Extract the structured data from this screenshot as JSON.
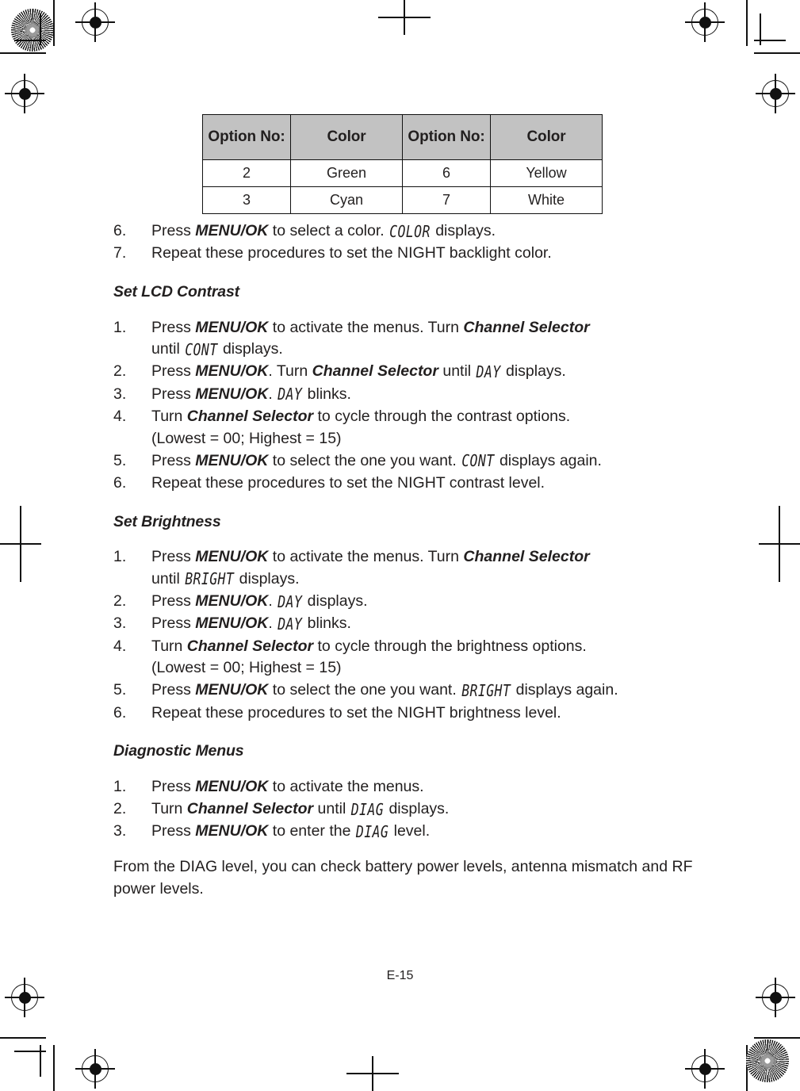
{
  "page": {
    "footer_label": "E-15"
  },
  "color_table": {
    "headers": [
      "Option No:",
      "Color",
      "Option No:",
      "Color"
    ],
    "rows": [
      [
        "2",
        "Green",
        "6",
        "Yellow"
      ],
      [
        "3",
        "Cyan",
        "7",
        "White"
      ]
    ]
  },
  "top_steps": [
    {
      "num": "6.",
      "parts": [
        {
          "t": "text",
          "v": "Press "
        },
        {
          "t": "bold",
          "v": "MENU/OK"
        },
        {
          "t": "text",
          "v": " to select a color. "
        },
        {
          "t": "lcd",
          "v": "COLOR"
        },
        {
          "t": "text",
          "v": " displays."
        }
      ]
    },
    {
      "num": "7.",
      "parts": [
        {
          "t": "text",
          "v": "Repeat these procedures to set the NIGHT backlight color."
        }
      ]
    }
  ],
  "sections": [
    {
      "heading": "Set LCD Contrast",
      "steps": [
        {
          "num": "1.",
          "parts": [
            {
              "t": "text",
              "v": "Press "
            },
            {
              "t": "bold",
              "v": "MENU/OK"
            },
            {
              "t": "text",
              "v": " to activate the menus. Turn "
            },
            {
              "t": "bold",
              "v": "Channel Selector"
            },
            {
              "t": "br"
            },
            {
              "t": "text",
              "v": "until "
            },
            {
              "t": "lcd",
              "v": "CONT"
            },
            {
              "t": "text",
              "v": " displays."
            }
          ]
        },
        {
          "num": "2.",
          "parts": [
            {
              "t": "text",
              "v": "Press "
            },
            {
              "t": "bold",
              "v": "MENU/OK"
            },
            {
              "t": "text",
              "v": ". Turn "
            },
            {
              "t": "bold",
              "v": "Channel Selector"
            },
            {
              "t": "text",
              "v": " until "
            },
            {
              "t": "lcd",
              "v": "DAY"
            },
            {
              "t": "text",
              "v": " displays."
            }
          ]
        },
        {
          "num": "3.",
          "parts": [
            {
              "t": "text",
              "v": "Press "
            },
            {
              "t": "bold",
              "v": "MENU/OK"
            },
            {
              "t": "text",
              "v": ". "
            },
            {
              "t": "lcd",
              "v": "DAY"
            },
            {
              "t": "text",
              "v": " blinks."
            }
          ]
        },
        {
          "num": "4.",
          "parts": [
            {
              "t": "text",
              "v": "Turn "
            },
            {
              "t": "bold",
              "v": "Channel Selector"
            },
            {
              "t": "text",
              "v": " to cycle through the contrast options."
            },
            {
              "t": "br"
            },
            {
              "t": "text",
              "v": "(Lowest = 00; Highest = 15)"
            }
          ]
        },
        {
          "num": "5.",
          "parts": [
            {
              "t": "text",
              "v": "Press "
            },
            {
              "t": "bold",
              "v": "MENU/OK"
            },
            {
              "t": "text",
              "v": " to select the one you want. "
            },
            {
              "t": "lcd",
              "v": "CONT"
            },
            {
              "t": "text",
              "v": " displays again."
            }
          ]
        },
        {
          "num": "6.",
          "parts": [
            {
              "t": "text",
              "v": "Repeat these procedures to set the NIGHT contrast level."
            }
          ]
        }
      ]
    },
    {
      "heading": "Set Brightness",
      "steps": [
        {
          "num": "1.",
          "parts": [
            {
              "t": "text",
              "v": "Press "
            },
            {
              "t": "bold",
              "v": "MENU/OK"
            },
            {
              "t": "text",
              "v": " to activate the menus. Turn "
            },
            {
              "t": "bold",
              "v": "Channel Selector"
            },
            {
              "t": "br"
            },
            {
              "t": "text",
              "v": "until "
            },
            {
              "t": "lcd",
              "v": "BRIGHT"
            },
            {
              "t": "text",
              "v": " displays."
            }
          ]
        },
        {
          "num": "2.",
          "parts": [
            {
              "t": "text",
              "v": "Press "
            },
            {
              "t": "bold",
              "v": "MENU/OK"
            },
            {
              "t": "text",
              "v": ". "
            },
            {
              "t": "lcd",
              "v": "DAY"
            },
            {
              "t": "text",
              "v": " displays."
            }
          ]
        },
        {
          "num": "3.",
          "parts": [
            {
              "t": "text",
              "v": "Press "
            },
            {
              "t": "bold",
              "v": "MENU/OK"
            },
            {
              "t": "text",
              "v": ". "
            },
            {
              "t": "lcd",
              "v": "DAY"
            },
            {
              "t": "text",
              "v": " blinks."
            }
          ]
        },
        {
          "num": "4.",
          "parts": [
            {
              "t": "text",
              "v": "Turn "
            },
            {
              "t": "bold",
              "v": "Channel Selector"
            },
            {
              "t": "text",
              "v": " to cycle through the brightness options."
            },
            {
              "t": "br"
            },
            {
              "t": "text",
              "v": "(Lowest = 00; Highest = 15)"
            }
          ]
        },
        {
          "num": "5.",
          "parts": [
            {
              "t": "text",
              "v": "Press "
            },
            {
              "t": "bold",
              "v": "MENU/OK"
            },
            {
              "t": "text",
              "v": " to select the one you want. "
            },
            {
              "t": "lcd",
              "v": "BRIGHT"
            },
            {
              "t": "text",
              "v": " displays again."
            }
          ]
        },
        {
          "num": "6.",
          "parts": [
            {
              "t": "text",
              "v": "Repeat these procedures to set the NIGHT brightness level."
            }
          ]
        }
      ]
    },
    {
      "heading": "Diagnostic Menus",
      "steps": [
        {
          "num": "1.",
          "parts": [
            {
              "t": "text",
              "v": "Press "
            },
            {
              "t": "bold",
              "v": "MENU/OK"
            },
            {
              "t": "text",
              "v": " to activate the menus."
            }
          ]
        },
        {
          "num": "2.",
          "parts": [
            {
              "t": "text",
              "v": "Turn "
            },
            {
              "t": "bold",
              "v": "Channel Selector"
            },
            {
              "t": "text",
              "v": " until "
            },
            {
              "t": "lcd",
              "v": "DIAG"
            },
            {
              "t": "text",
              "v": " displays."
            }
          ]
        },
        {
          "num": "3.",
          "parts": [
            {
              "t": "text",
              "v": "Press "
            },
            {
              "t": "bold",
              "v": "MENU/OK"
            },
            {
              "t": "text",
              "v": " to enter the "
            },
            {
              "t": "lcd",
              "v": "DIAG"
            },
            {
              "t": "text",
              "v": " level."
            }
          ]
        }
      ],
      "paragraph": "From the DIAG  level, you can check battery power levels, antenna mismatch and RF power levels."
    }
  ]
}
